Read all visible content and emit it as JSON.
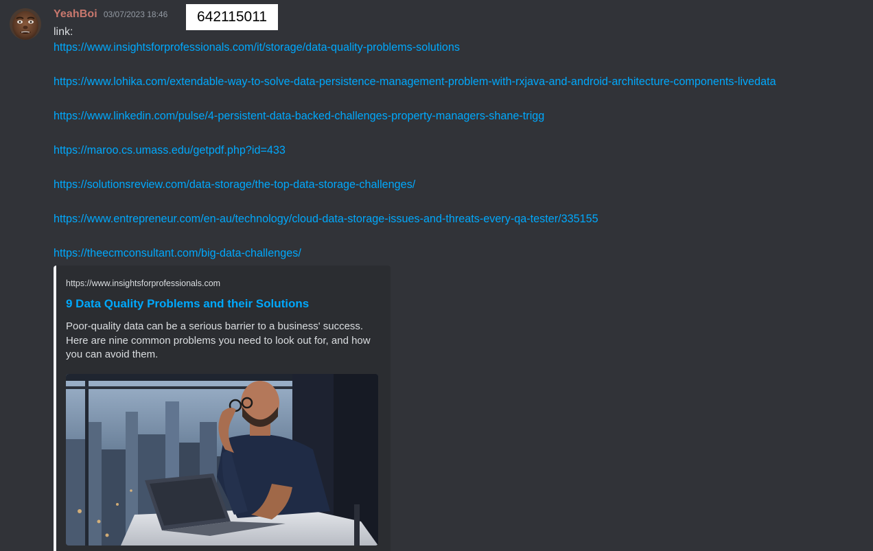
{
  "message": {
    "author": "YeahBoi",
    "timestamp": "03/07/2023 18:46",
    "id_label": "642115011",
    "intro": "link:",
    "links": [
      "https://www.insightsforprofessionals.com/it/storage/data-quality-problems-solutions",
      "https://www.lohika.com/extendable-way-to-solve-data-persistence-management-problem-with-rxjava-and-android-architecture-components-livedata",
      "https://www.linkedin.com/pulse/4-persistent-data-backed-challenges-property-managers-shane-trigg",
      "https://maroo.cs.umass.edu/getpdf.php?id=433",
      "https://solutionsreview.com/data-storage/the-top-data-storage-challenges/",
      "https://www.entrepreneur.com/en-au/technology/cloud-data-storage-issues-and-threats-every-qa-tester/335155",
      "https://theecmconsultant.com/big-data-challenges/"
    ]
  },
  "embed": {
    "provider": "https://www.insightsforprofessionals.com",
    "title": "9 Data Quality Problems and their Solutions",
    "description": "Poor-quality data can be a serious barrier to a business' success. Here are nine common problems you need to look out for, and how you can avoid them.",
    "image_subject": "man-with-glasses-at-laptop-photo"
  },
  "colors": {
    "background": "#313338",
    "username": "#c9786e",
    "link": "#00a8fc",
    "text": "#dbdee1",
    "embed_background": "#2b2d31"
  }
}
